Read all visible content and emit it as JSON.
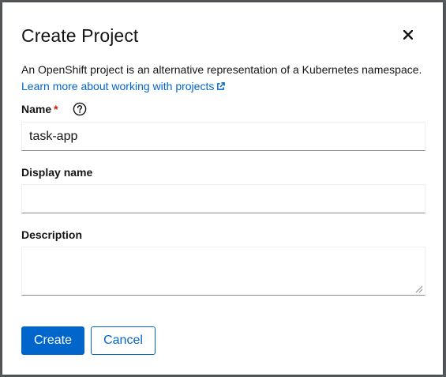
{
  "modal": {
    "title": "Create Project",
    "description": "An OpenShift project is an alternative representation of a Kubernetes namespace.",
    "learn_more_link": "Learn more about working with projects",
    "close_icon": "close-icon",
    "external_link_icon": "external-link-icon"
  },
  "form": {
    "name": {
      "label": "Name",
      "required_marker": "*",
      "help_icon": "question-circle-icon",
      "value": "task-app"
    },
    "display_name": {
      "label": "Display name",
      "value": ""
    },
    "description": {
      "label": "Description",
      "value": ""
    }
  },
  "actions": {
    "create_label": "Create",
    "cancel_label": "Cancel"
  },
  "colors": {
    "primary": "#0066cc",
    "required": "#c9190b",
    "text": "#151515"
  }
}
